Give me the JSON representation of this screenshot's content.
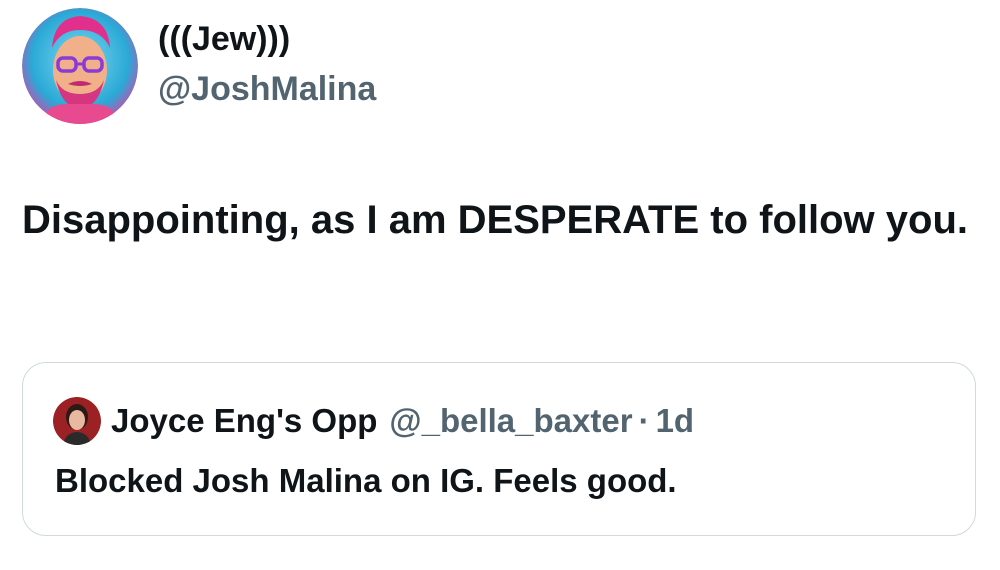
{
  "tweet": {
    "author": {
      "display_name": "(((Jew)))",
      "handle": "@JoshMalina",
      "avatar": "illustrated-portrait-avatar"
    },
    "text": "Disappointing, as I am DESPERATE to follow you."
  },
  "quoted_tweet": {
    "author": {
      "display_name": "Joyce Eng's Opp",
      "handle": "@_bella_baxter",
      "avatar": "photo-portrait-avatar"
    },
    "separator": "·",
    "time": "1d",
    "text": "Blocked Josh Malina on IG. Feels good."
  },
  "colors": {
    "primary_text": "#0f1419",
    "secondary_text": "#536471",
    "border": "#cfd9de",
    "background": "#ffffff"
  }
}
